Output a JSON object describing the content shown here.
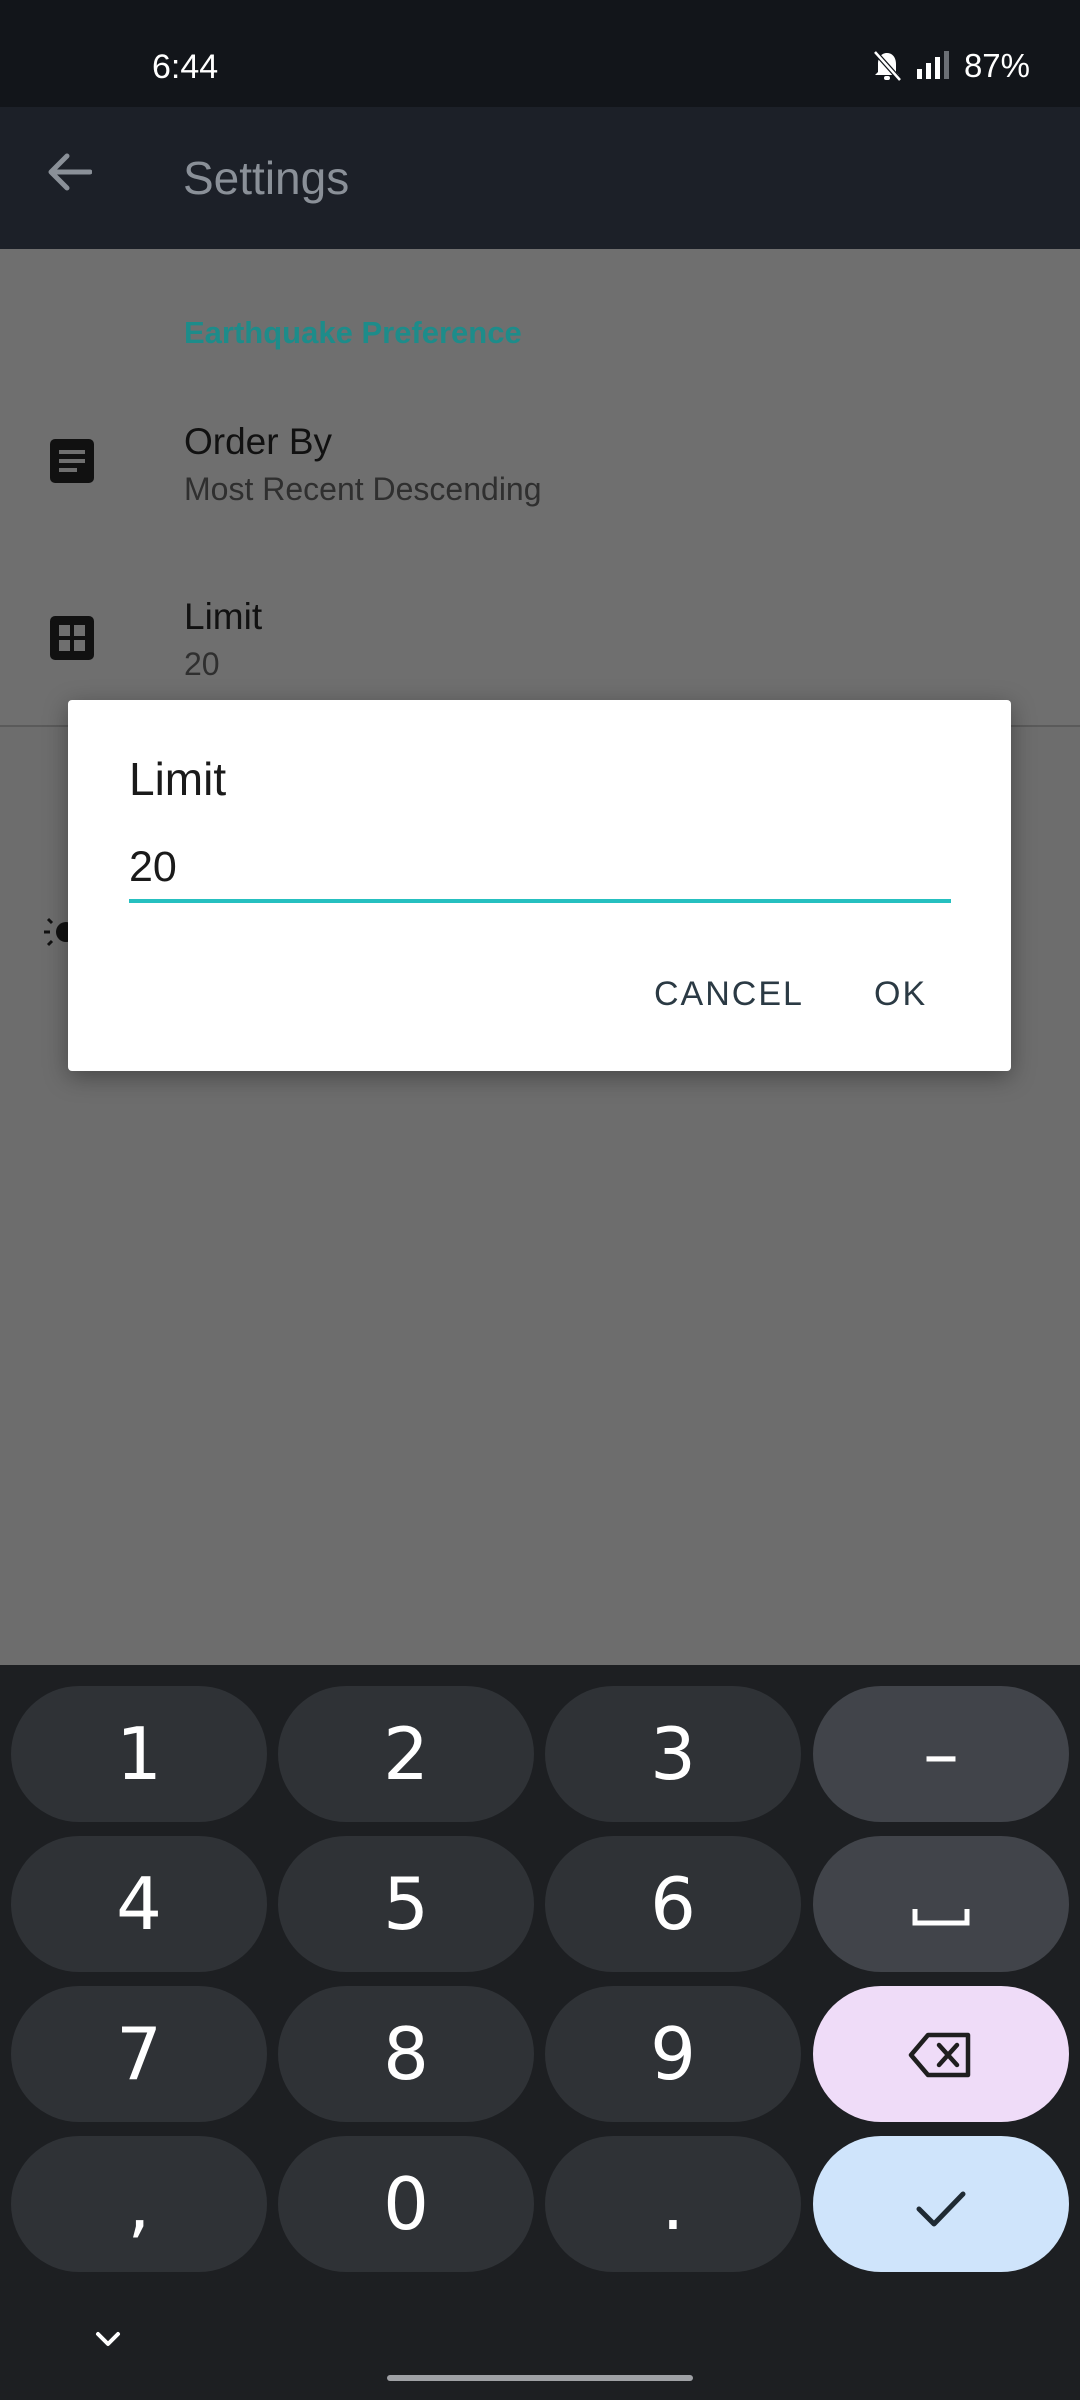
{
  "status_bar": {
    "time": "6:44",
    "battery": "87%",
    "icons": [
      "bell-off-icon",
      "signal-icon"
    ]
  },
  "app_bar": {
    "title": "Settings",
    "back_icon": "arrow-back-icon"
  },
  "settings": {
    "section_title": "Earthquake Preference",
    "items": [
      {
        "title": "Order By",
        "summary": "Most Recent Descending",
        "icon": "list-icon"
      },
      {
        "title": "Limit",
        "summary": "20",
        "icon": "grid-icon"
      }
    ]
  },
  "dialog": {
    "title": "Limit",
    "input_value": "20",
    "cancel_label": "CANCEL",
    "ok_label": "OK"
  },
  "keyboard": {
    "keys": [
      "1",
      "2",
      "3",
      "–",
      "4",
      "5",
      "6",
      "␣",
      "7",
      "8",
      "9",
      "⌫",
      ",",
      "0",
      ".",
      "✓"
    ]
  },
  "colors": {
    "accent": "#26c0c0",
    "section_title": "#1d8c8a",
    "status_bar": "#12151a",
    "app_bar": "#1c2028",
    "keyboard_bg": "#1d1f22",
    "backspace_key": "#efdcf8",
    "enter_key": "#cfe4fb"
  }
}
